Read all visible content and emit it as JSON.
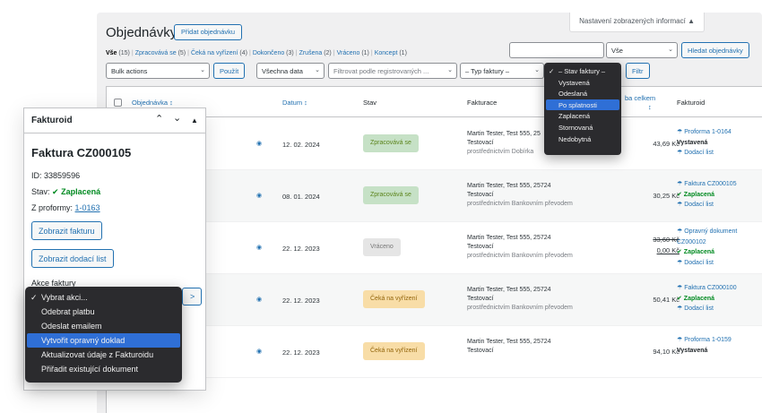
{
  "screen_options": "Nastavení zobrazených informací ▲",
  "page": {
    "title": "Objednávky",
    "add_button": "Přidat objednávku"
  },
  "views": [
    {
      "label": "Vše",
      "count": "(15)"
    },
    {
      "label": "Zpracovává se",
      "count": "(5)"
    },
    {
      "label": "Čeká na vyřízení",
      "count": "(4)"
    },
    {
      "label": "Dokončeno",
      "count": "(3)"
    },
    {
      "label": "Zrušena",
      "count": "(2)"
    },
    {
      "label": "Vráceno",
      "count": "(1)"
    },
    {
      "label": "Koncept",
      "count": "(1)"
    }
  ],
  "search": {
    "scope": "Vše",
    "button": "Hledat objednávky"
  },
  "filters": {
    "bulk_actions": "Bulk actions",
    "apply": "Použít",
    "dates": "Všechna data",
    "customer": "Filtrovat podle registrovaných ...",
    "invoice_type": "– Typ faktury –",
    "filter_button": "Filtr"
  },
  "stav_dropdown": {
    "options": [
      "– Stav faktury –",
      "Vystavená",
      "Odeslaná",
      "Po splatnosti",
      "Zaplacená",
      "Stornovaná",
      "Nedobytná"
    ],
    "selected": 0,
    "highlighted": 3
  },
  "table": {
    "headers": {
      "order": "Objednávka ↕",
      "date": "Datum ↕",
      "status": "Stav",
      "billing": "Fakturace",
      "total": "ba celkem",
      "total_sort": "↕",
      "fakturoid": "Fakturoid"
    },
    "rows": [
      {
        "date": "12. 02. 2024",
        "status": "Zpracovává se",
        "status_kind": "processing",
        "bill_name": "Martin Tester, Test 555, 25",
        "bill_city": "Testovací",
        "bill_via": "prostřednictvím Dobírka",
        "total": "43,69 Kč",
        "total_old": "",
        "fak": [
          {
            "t": "☂ Proforma 1-0164",
            "k": "link"
          },
          {
            "t": "Vystavená",
            "k": "b"
          },
          {
            "t": "☂ Dodací list",
            "k": "link"
          }
        ]
      },
      {
        "date": "08. 01. 2024",
        "status": "Zpracovává se",
        "status_kind": "processing",
        "bill_name": "Martin Tester, Test 555, 25724",
        "bill_city": "Testovací",
        "bill_via": "prostřednictvím Bankovním převodem",
        "total": "30,25 Kč",
        "total_old": "",
        "fak": [
          {
            "t": "☂ Faktura CZ000105",
            "k": "link"
          },
          {
            "t": "✔ Zaplacená",
            "k": "ok"
          },
          {
            "t": "☂ Dodací list",
            "k": "link"
          }
        ]
      },
      {
        "date": "22. 12. 2023",
        "status": "Vráceno",
        "status_kind": "refunded",
        "bill_name": "Martin Tester, Test 555, 25724",
        "bill_city": "Testovací",
        "bill_via": "prostřednictvím Bankovním převodem",
        "total": "0,00 Kč",
        "total_old": "33,60 Kč",
        "fak": [
          {
            "t": "☂ Opravný dokument",
            "k": "link"
          },
          {
            "t": "CZ000102",
            "k": "link"
          },
          {
            "t": "✔ Zaplacená",
            "k": "ok"
          },
          {
            "t": "☂ Dodací list",
            "k": "link"
          }
        ]
      },
      {
        "date": "22. 12. 2023",
        "status": "Čeká na vyřízení",
        "status_kind": "hold",
        "bill_name": "Martin Tester, Test 555, 25724",
        "bill_city": "Testovací",
        "bill_via": "prostřednictvím Bankovním převodem",
        "total": "50,41 Kč",
        "total_old": "",
        "fak": [
          {
            "t": "☂ Faktura CZ000100",
            "k": "link"
          },
          {
            "t": "✔ Zaplacená",
            "k": "ok"
          },
          {
            "t": "☂ Dodací list",
            "k": "link"
          }
        ]
      },
      {
        "date": "22. 12. 2023",
        "status": "Čeká na vyřízení",
        "status_kind": "hold",
        "bill_name": "Martin Tester, Test 555, 25724",
        "bill_city": "Testovací",
        "bill_via": "",
        "total": "94,10 Kč",
        "total_old": "",
        "fak": [
          {
            "t": "☂ Proforma 1-0159",
            "k": "link"
          },
          {
            "t": "Vystavená",
            "k": "b"
          }
        ]
      }
    ]
  },
  "panel": {
    "title": "Fakturoid",
    "invoice": "Faktura CZ000105",
    "id_label": "ID:",
    "id_value": "33859596",
    "state_label": "Stav:",
    "state_value": "✔ Zaplacená",
    "proforma_label": "Z proformy:",
    "proforma_value": "1-0163",
    "show_invoice": "Zobrazit fakturu",
    "show_delivery": "Zobrazit dodací list",
    "actions_label": "Akce faktury",
    "go": ">"
  },
  "akce_dropdown": {
    "options": [
      "Vybrat akci...",
      "Odebrat platbu",
      "Odeslat emailem",
      "Vytvořit opravný doklad",
      "Aktualizovat údaje z Fakturoidu",
      "Přiřadit existující dokument"
    ],
    "selected": 0,
    "highlighted": 3
  }
}
